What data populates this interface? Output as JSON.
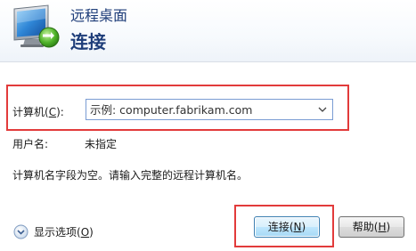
{
  "header": {
    "app_title": "远程桌面",
    "page_title": "连接"
  },
  "form": {
    "computer_label": "计算机(",
    "computer_accesskey": "C",
    "computer_label_suffix": "):",
    "computer_value": "",
    "computer_placeholder": "示例: computer.fabrikam.com",
    "username_label": "用户名:",
    "username_value": "未指定",
    "hint": "计算机名字段为空。请输入完整的远程计算机名。"
  },
  "footer": {
    "options_label": "显示选项(",
    "options_accesskey": "O",
    "options_label_suffix": ")",
    "connect_label": "连接(",
    "connect_accesskey": "N",
    "connect_label_suffix": ")",
    "help_label": "帮助(",
    "help_accesskey": "H",
    "help_label_suffix": ")"
  },
  "icons": {
    "app": "remote-desktop-icon",
    "combo": "chevron-down-icon",
    "options": "expand-circle-icon"
  },
  "colors": {
    "title": "#1e3d79",
    "highlight": "#e23b3b",
    "input_border": "#7a9cd3"
  }
}
